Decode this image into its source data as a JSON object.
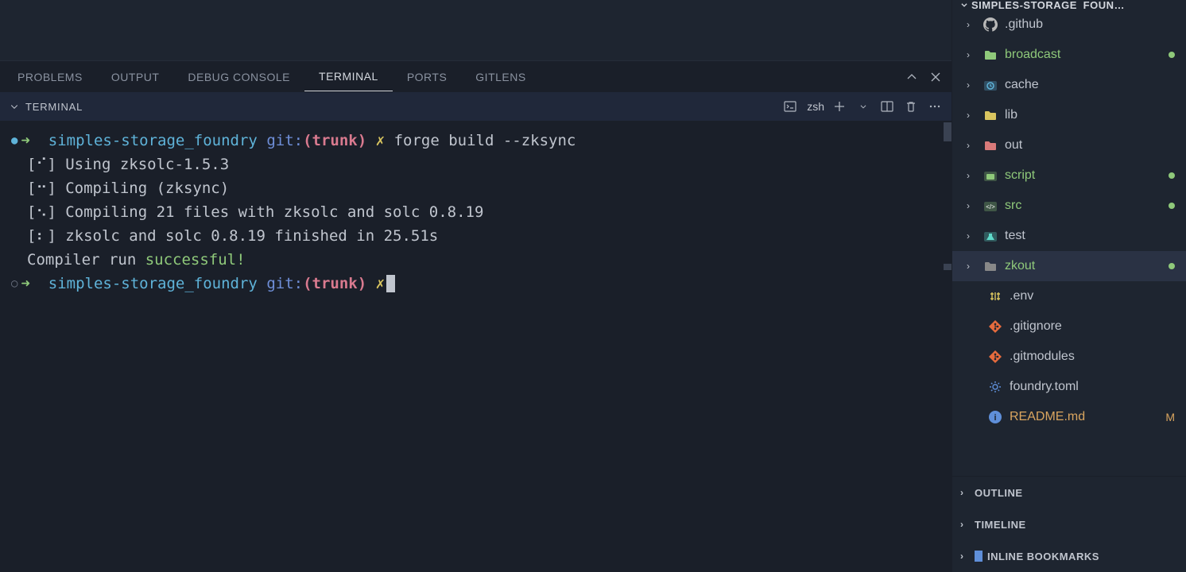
{
  "panel": {
    "tabs": [
      "PROBLEMS",
      "OUTPUT",
      "DEBUG CONSOLE",
      "TERMINAL",
      "PORTS",
      "GITLENS"
    ],
    "active_index": 3,
    "terminal_caption": "TERMINAL",
    "shell_name": "zsh"
  },
  "terminal": {
    "prompt_parts": {
      "path": "simples-storage_foundry",
      "git_label": "git:",
      "branch": "trunk",
      "marker": "✗"
    },
    "command1": "forge build --zksync",
    "output": [
      "[⠊] Using zksolc-1.5.3",
      "[⠒] Compiling (zksync)",
      "[⠢] Compiling 21 files with zksolc and solc 0.8.19",
      "[⠆] zksolc and solc 0.8.19 finished in 25.51s"
    ],
    "compiler_run": "Compiler run ",
    "successful": "successful!"
  },
  "explorer": {
    "title": "SIMPLES-STORAGE_FOUN…",
    "tree": [
      {
        "type": "folder",
        "name": ".github",
        "icon": "github",
        "color": "#b8b8b8"
      },
      {
        "type": "folder",
        "name": "broadcast",
        "icon": "folder",
        "color": "#8fc97a",
        "git": "untracked"
      },
      {
        "type": "folder",
        "name": "cache",
        "icon": "cache",
        "color": "#5fb3d9"
      },
      {
        "type": "folder",
        "name": "lib",
        "icon": "folder",
        "color": "#d9c55f"
      },
      {
        "type": "folder",
        "name": "out",
        "icon": "folder",
        "color": "#d97a7a"
      },
      {
        "type": "folder",
        "name": "script",
        "icon": "script",
        "color": "#8fc97a",
        "git": "untracked"
      },
      {
        "type": "folder",
        "name": "src",
        "icon": "src",
        "color": "#8fc97a",
        "git": "untracked"
      },
      {
        "type": "folder",
        "name": "test",
        "icon": "test",
        "color": "#5fd9c9"
      },
      {
        "type": "folder",
        "name": "zkout",
        "icon": "folder",
        "color": "#888",
        "git": "untracked",
        "selected": true
      },
      {
        "type": "file",
        "name": ".env",
        "icon": "env",
        "color": "#d9c55f",
        "indent": 1
      },
      {
        "type": "file",
        "name": ".gitignore",
        "icon": "git",
        "color": "#e66b3d",
        "indent": 1
      },
      {
        "type": "file",
        "name": ".gitmodules",
        "icon": "git",
        "color": "#e66b3d",
        "indent": 1
      },
      {
        "type": "file",
        "name": "foundry.toml",
        "icon": "gear",
        "color": "#5f8fd9",
        "indent": 1
      },
      {
        "type": "file",
        "name": "README.md",
        "icon": "info",
        "color": "#5f8fd9",
        "git": "modified",
        "indent": 1
      }
    ],
    "sections": [
      "OUTLINE",
      "TIMELINE",
      "INLINE BOOKMARKS"
    ]
  }
}
